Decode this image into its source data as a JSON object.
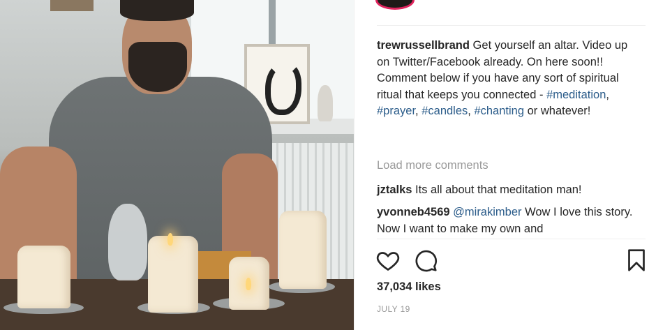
{
  "post": {
    "image_alt_icon": "photo",
    "caption": {
      "username": "trewrussellbrand",
      "text_1": " Get yourself an altar. Video up on Twitter/Facebook already. On here soon!! Comment below if you have any sort of spiritual ritual that keeps you connected - ",
      "hashtags": [
        "#meditation",
        "#prayer",
        "#candles",
        "#chanting"
      ],
      "text_2": " or whatever!"
    },
    "load_more_label": "Load more comments",
    "comments": [
      {
        "username": "jztalks",
        "mention": "",
        "text": " Its all about that meditation man!"
      },
      {
        "username": "yvonneb4569",
        "mention": "@mirakimber",
        "text": " Wow I love this story. Now I want to make my own and"
      }
    ],
    "likes": "37,034 likes",
    "date": "JULY 19",
    "icons": {
      "like": "heart-icon",
      "comment": "comment-icon",
      "save": "bookmark-icon"
    },
    "colors": {
      "link": "#2b5c8a",
      "muted": "#999999",
      "text": "#262626"
    }
  }
}
